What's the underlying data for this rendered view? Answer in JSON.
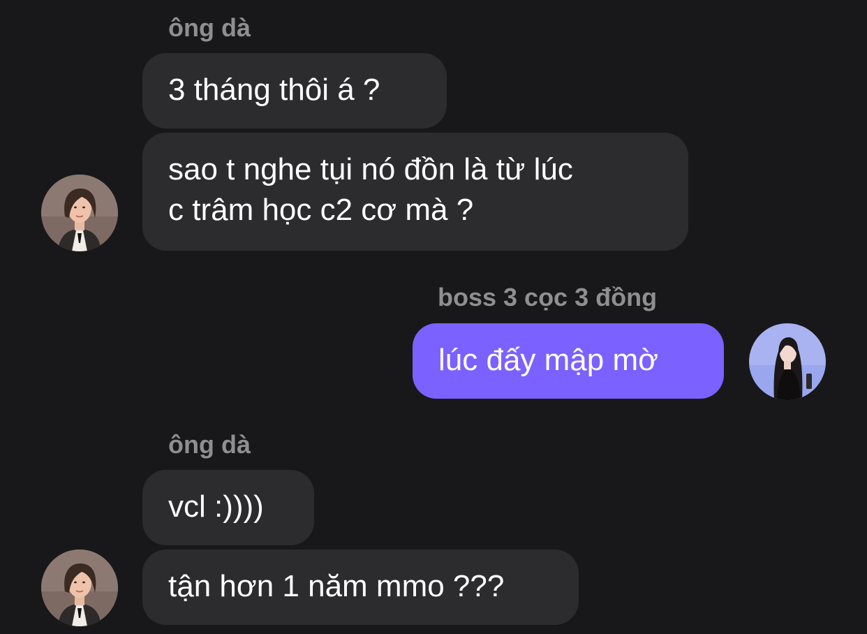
{
  "conversation": {
    "groups": [
      {
        "sender": "ông dà",
        "messages": [
          {
            "lines": [
              "3 tháng thôi á ?"
            ]
          },
          {
            "lines": [
              "sao t nghe tụi nó đồn là từ lúc",
              "c trâm học c2 cơ mà ?"
            ]
          }
        ]
      },
      {
        "sender": "boss 3 cọc 3 đồng",
        "messages": [
          {
            "lines": [
              "lúc đấy mập mờ"
            ]
          }
        ]
      },
      {
        "sender": "ông dà",
        "messages": [
          {
            "lines": [
              "vcl :))))"
            ]
          },
          {
            "lines": [
              "tận hơn 1 năm mmo ???"
            ]
          }
        ]
      }
    ]
  },
  "colors": {
    "background": "#18181a",
    "incoming_bubble": "#2c2c2e",
    "outgoing_bubble": "#7b61ff",
    "sender_name": "#8e8e93",
    "text": "#ffffff"
  },
  "icons": {
    "incoming_avatar": "woman-short-hair-avatar-icon",
    "outgoing_avatar": "woman-long-hair-avatar-icon"
  }
}
